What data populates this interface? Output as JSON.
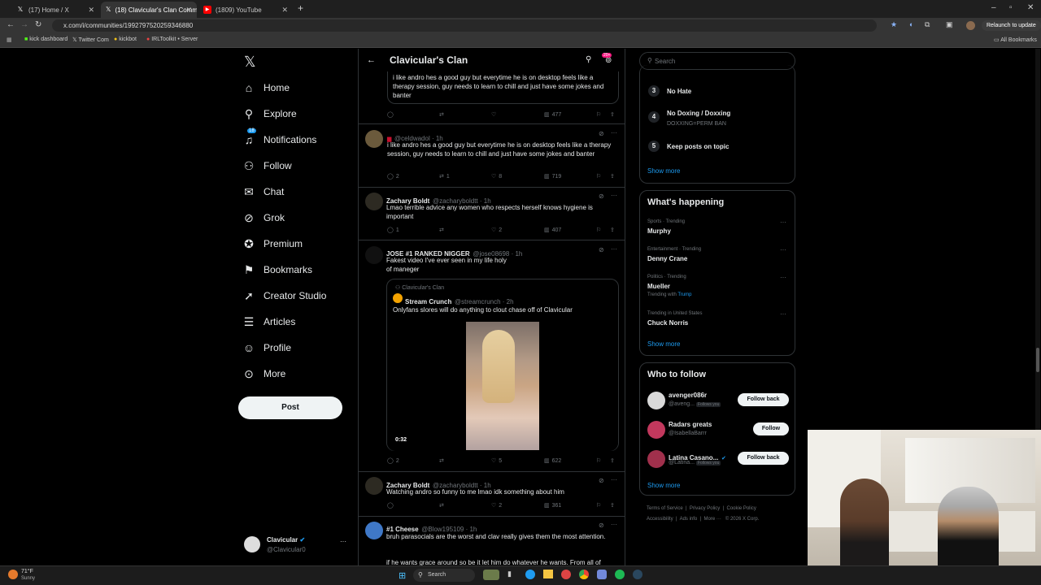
{
  "browser": {
    "tabs": [
      {
        "title": "(17) Home / X",
        "icon": "x-logo-icon",
        "close": "✕"
      },
      {
        "title": "(18) Clavicular's Clan Communi",
        "icon": "x-logo-icon",
        "close": "✕"
      },
      {
        "title": "(1809) YouTube",
        "icon": "youtube-icon",
        "close": "✕"
      }
    ],
    "new_tab": "+",
    "url": "x.com/i/communities/1992797520259346880",
    "relaunch_label": "Relaunch to update",
    "bookmarks": [
      "kick dashboard",
      "Twitter Com",
      "kickbot",
      "IRLToolkit • Server"
    ],
    "all_bookmarks": "All Bookmarks"
  },
  "sidebar": {
    "logo": "𝕏",
    "items": [
      {
        "label": "Home",
        "icon": "home-icon",
        "glyph": "⌂"
      },
      {
        "label": "Explore",
        "icon": "search-icon",
        "glyph": "⚲"
      },
      {
        "label": "Notifications",
        "icon": "bell-icon",
        "glyph": "🔔",
        "badge": "18"
      },
      {
        "label": "Follow",
        "icon": "follow-icon",
        "glyph": "👤"
      },
      {
        "label": "Chat",
        "icon": "mail-icon",
        "glyph": "✉"
      },
      {
        "label": "Grok",
        "icon": "grok-icon",
        "glyph": "⊘"
      },
      {
        "label": "Premium",
        "icon": "premium-icon",
        "glyph": "✪"
      },
      {
        "label": "Bookmarks",
        "icon": "bookmark-icon",
        "glyph": "🔖"
      },
      {
        "label": "Creator Studio",
        "icon": "rocket-icon",
        "glyph": "🚀"
      },
      {
        "label": "Articles",
        "icon": "articles-icon",
        "glyph": "☰"
      },
      {
        "label": "Profile",
        "icon": "profile-icon",
        "glyph": "👤"
      },
      {
        "label": "More",
        "icon": "more-circle-icon",
        "glyph": "⋯"
      }
    ],
    "post_label": "Post",
    "account": {
      "name": "Clavicular",
      "handle": "@Clavicular0",
      "more": "···"
    }
  },
  "feed": {
    "header_title": "Clavicular's Clan",
    "header_badge": "20+",
    "posts": [
      {
        "text": "i like andro hes a good guy but everytime he is on desktop feels like a therapy session, guy needs to learn to chill and just have some jokes and banter",
        "reply": "",
        "repost": "",
        "like": "",
        "views": "477"
      },
      {
        "name": "",
        "handle": "@celdwadol · 1h",
        "text": "i like andro hes a good guy but everytime he is on desktop feels like a therapy session, guy needs to learn to chill and just have some jokes and banter",
        "reply": "2",
        "repost": "1",
        "like": "8",
        "views": "719"
      },
      {
        "name": "Zachary Boldt",
        "handle": "@zacharyboldtt · 1h",
        "text": "Lmao terrible advice any women who respects herself knows hygiene is important",
        "reply": "1",
        "repost": "",
        "like": "2",
        "views": "407"
      },
      {
        "name": "JOSE #1 RANKED NIGGER",
        "handle": "@jose08698 · 1h",
        "text": "Fakest video I've ever seen in my life holy of maneger",
        "quote": {
          "community": "Clavicular's Clan",
          "name": "Stream Crunch",
          "handle": "@streamcrunch · 2h",
          "text": "Onlyfans slores will do anything to clout chase off of Clavicular",
          "duration": "0:32"
        },
        "reply": "2",
        "repost": "",
        "like": "5",
        "views": "622"
      },
      {
        "name": "Zachary Boldt",
        "handle": "@zacharyboldtt · 1h",
        "text": "Watching andro so funny to me lmao idk something about him",
        "reply": "",
        "repost": "",
        "like": "2",
        "views": "361"
      },
      {
        "name": "#1 Cheese",
        "handle": "@Blow195109 · 1h",
        "text": "bruh parasocials are the worst and clav really gives them the most attention.",
        "text2": "if he wants grace around so be it let him do whatever he wants. From all of"
      }
    ]
  },
  "right": {
    "search_placeholder": "Search",
    "rules": [
      {
        "num": "3",
        "title": "No Hate",
        "sub": ""
      },
      {
        "num": "4",
        "title": "No Doxing / Doxxing",
        "sub": "DOXXING=PERM BAN"
      },
      {
        "num": "5",
        "title": "Keep posts on topic",
        "sub": ""
      }
    ],
    "show_more": "Show more",
    "happening_title": "What's happening",
    "trends": [
      {
        "context": "Sports · Trending",
        "title": "Murphy",
        "extra": ""
      },
      {
        "context": "Entertainment · Trending",
        "title": "Denny Crane",
        "extra": ""
      },
      {
        "context": "Politics · Trending",
        "title": "Mueller",
        "extra": "Trending with ",
        "extra_link": "Trump"
      },
      {
        "context": "Trending in United States",
        "title": "Chuck Norris",
        "extra": ""
      }
    ],
    "who_title": "Who to follow",
    "who": [
      {
        "name": "avenger086r",
        "handle": "@aveng...",
        "follows": "Follows you",
        "button": "Follow back",
        "color": "#d9d9d9"
      },
      {
        "name": "Radars greats",
        "handle": "@IsabellaBarrr",
        "follows": "",
        "button": "Follow",
        "color": "#c2385d"
      },
      {
        "name": "Latina Casano...",
        "handle": "@Latina...",
        "follows": "Follows you",
        "button": "Follow back",
        "color": "#a0304c"
      }
    ],
    "footer1": [
      "Terms of Service",
      "Privacy Policy",
      "Cookie Policy"
    ],
    "footer2": [
      "Accessibility",
      "Ads info",
      "More ···",
      "© 2026 X Corp."
    ]
  },
  "taskbar": {
    "weather_temp": "71°F",
    "weather_desc": "Sunny",
    "search": "Search"
  }
}
